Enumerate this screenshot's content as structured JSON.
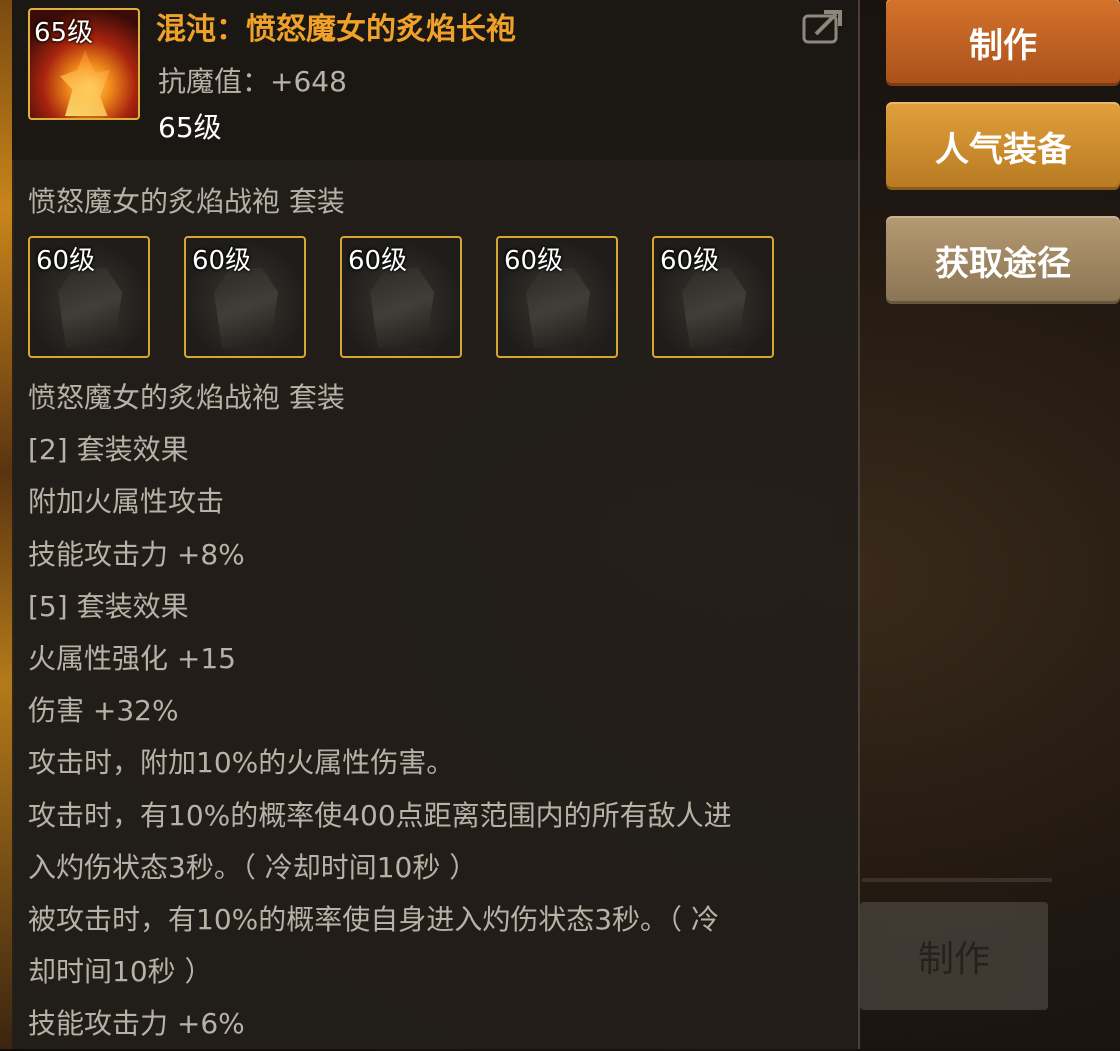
{
  "background": {
    "craft_button_label": "制作"
  },
  "item": {
    "level_tag": "65级",
    "title": "混沌：愤怒魔女的炙焰长袍",
    "resist_label": "抗魔值：+648",
    "level": "65级",
    "title_color": "#f0a12a"
  },
  "set": {
    "heading": "愤怒魔女的炙焰战袍  套装",
    "items": [
      {
        "level": "60级"
      },
      {
        "level": "60级"
      },
      {
        "level": "60级"
      },
      {
        "level": "60级"
      },
      {
        "level": "60级"
      }
    ],
    "border_color": "#d9a531"
  },
  "effects": [
    "愤怒魔女的炙焰战袍  套装",
    "[2] 套装效果",
    "附加火属性攻击",
    "技能攻击力 +8%",
    "[5] 套装效果",
    "火属性强化 +15",
    "伤害 +32%",
    "攻击时，附加10%的火属性伤害。",
    "攻击时，有10%的概率使400点距离范围内的所有敌人进",
    "入灼伤状态3秒。（ 冷却时间10秒 ）",
    "被攻击时，有10%的概率使自身进入灼伤状态3秒。（ 冷",
    "却时间10秒 ）",
    "技能攻击力 +6%"
  ],
  "buttons": {
    "craft": "制作",
    "popular": "人气装备",
    "source": "获取途径"
  },
  "icons": {
    "export": "share-export-icon"
  }
}
